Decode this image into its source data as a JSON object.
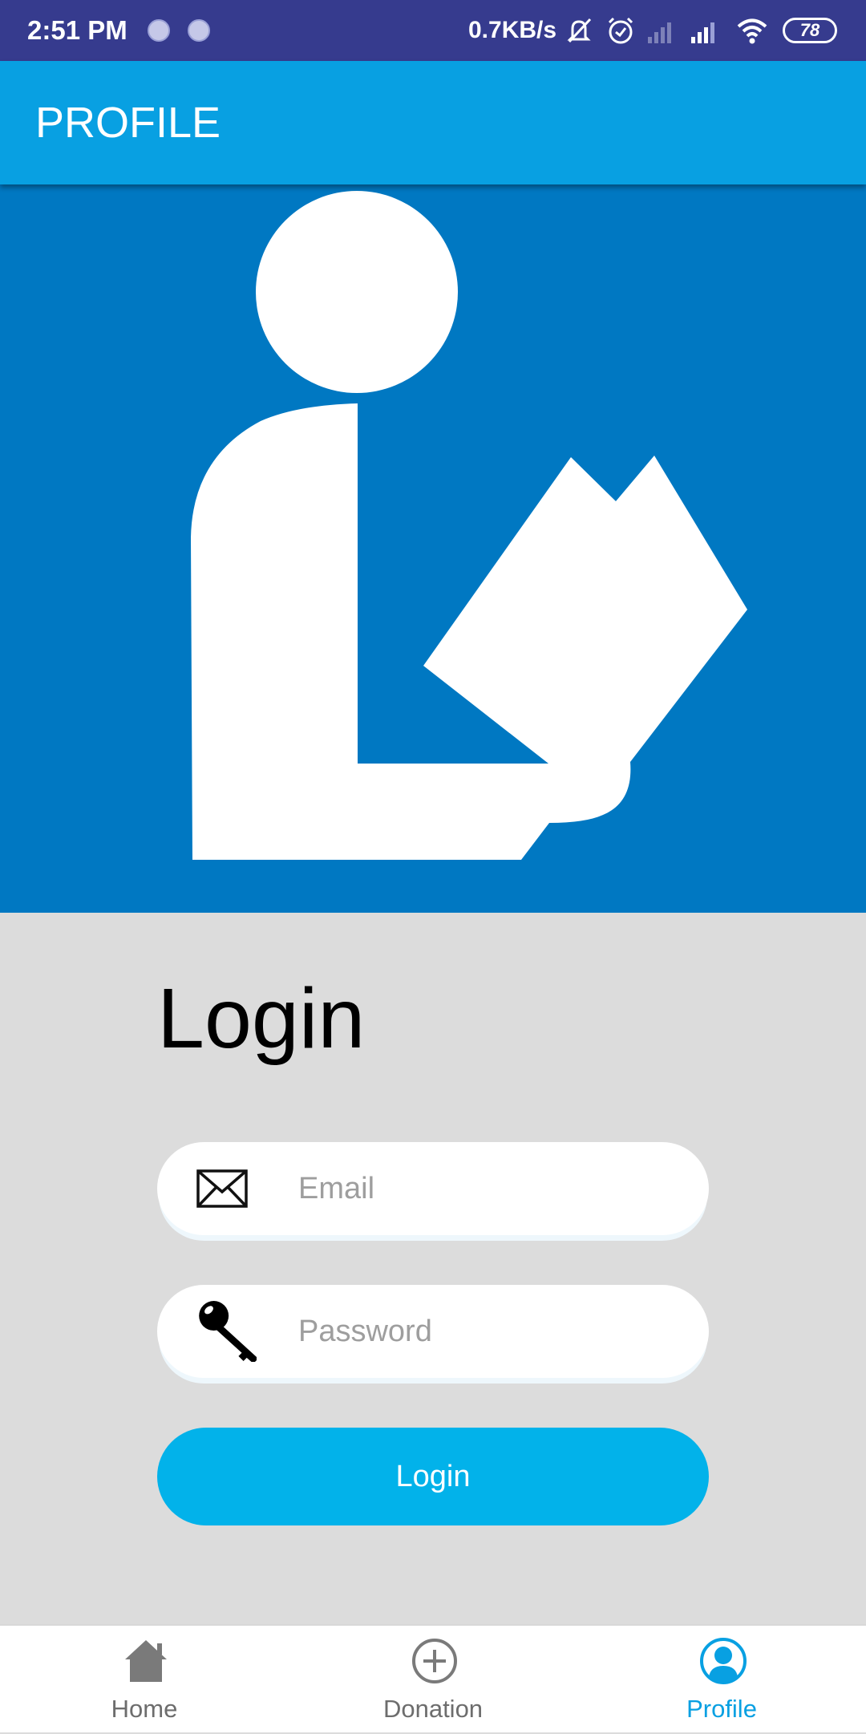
{
  "status_bar": {
    "time": "2:51 PM",
    "net_speed": "0.7KB/s",
    "battery": "78",
    "icons": [
      "sync-dot-icon",
      "sync-dot-icon",
      "mute-icon",
      "alarm-icon",
      "signal-none-icon",
      "signal-icon",
      "wifi-icon",
      "battery-icon"
    ]
  },
  "app_bar": {
    "title": "PROFILE"
  },
  "hero": {
    "icon": "reader-with-book-icon",
    "background_color": "#0078c2"
  },
  "login": {
    "title": "Login",
    "email": {
      "placeholder": "Email",
      "value": "",
      "icon": "envelope-icon"
    },
    "password": {
      "placeholder": "Password",
      "value": "",
      "icon": "key-icon"
    },
    "button_label": "Login"
  },
  "bottom_nav": {
    "items": [
      {
        "label": "Home",
        "icon": "home-icon",
        "active": false
      },
      {
        "label": "Donation",
        "icon": "add-circle-icon",
        "active": false
      },
      {
        "label": "Profile",
        "icon": "profile-icon",
        "active": true
      }
    ]
  },
  "colors": {
    "status_bar": "#363b8e",
    "app_bar": "#08a0e2",
    "button": "#02b2ea",
    "page": "#dcdcdc"
  }
}
